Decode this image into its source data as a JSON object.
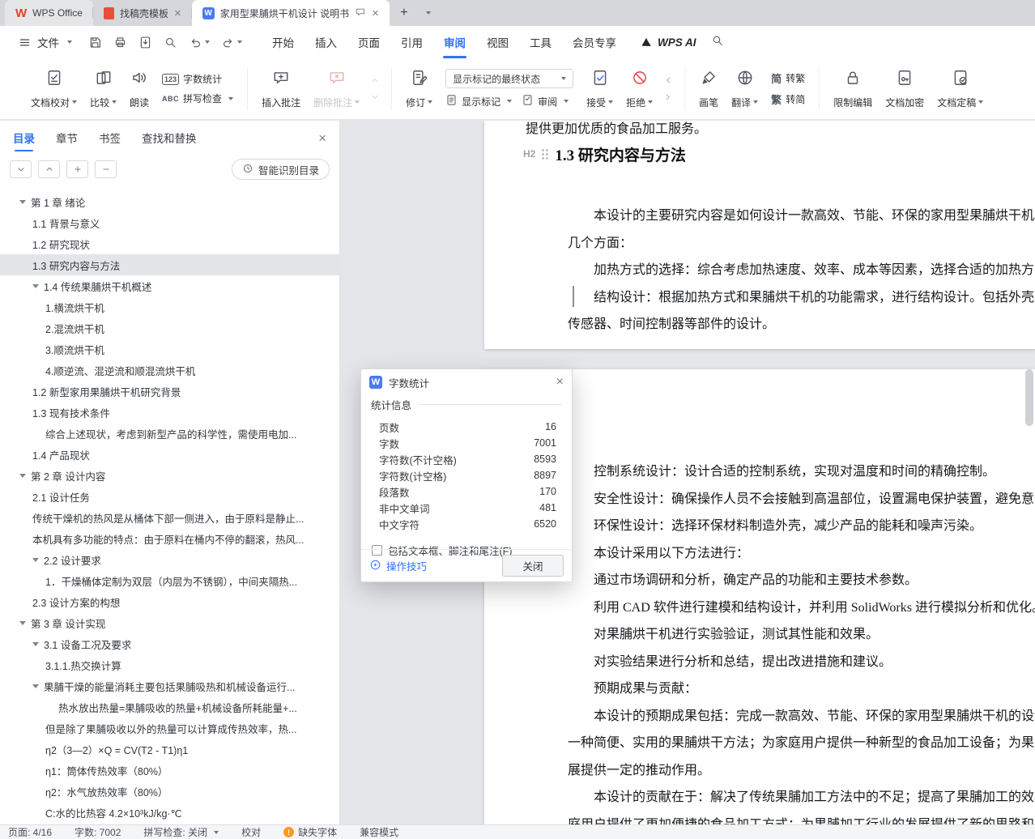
{
  "accent": "#3370ff",
  "tabbar": {
    "tabs": [
      {
        "label": "WPS Office"
      },
      {
        "label": "找稿壳模板"
      },
      {
        "label": "家用型果脯烘干机设计 说明书",
        "active": true
      }
    ]
  },
  "menubar": {
    "file_label": "文件",
    "items": [
      {
        "label": "开始"
      },
      {
        "label": "插入"
      },
      {
        "label": "页面"
      },
      {
        "label": "引用"
      },
      {
        "label": "审阅",
        "active": true
      },
      {
        "label": "视图"
      },
      {
        "label": "工具"
      },
      {
        "label": "会员专享"
      }
    ],
    "wps_ai_label": "WPS AI"
  },
  "ribbon": {
    "doc_proof": "文档校对",
    "compare": "比较",
    "read_aloud": "朗读",
    "word_count": "字数统计",
    "word_count_icon": "123",
    "spell_check": "拼写检查",
    "spell_icon": "ABC",
    "insert_comment": "插入批注",
    "delete_comment": "删除批注",
    "revise": "修订",
    "markup_state": "显示标记的最终状态",
    "show_markup": "显示标记",
    "review": "审阅",
    "accept": "接受",
    "reject": "拒绝",
    "brush": "画笔",
    "translate": "翻译",
    "to_trad_icon": "简",
    "to_trad": "转繁",
    "to_simp_icon": "繁",
    "to_simp": "转简",
    "restrict_edit": "限制编辑",
    "encrypt": "文档加密",
    "finalize": "文档定稿"
  },
  "sidebar": {
    "tabs": [
      {
        "label": "目录",
        "active": true
      },
      {
        "label": "章节"
      },
      {
        "label": "书签"
      },
      {
        "label": "查找和替换"
      }
    ],
    "smart_button": "智能识别目录",
    "outline": [
      {
        "label": "第 1 章  绪论",
        "level": 0,
        "expandable": true
      },
      {
        "label": "1.1 背景与意义",
        "level": 1
      },
      {
        "label": "1.2 研究现状",
        "level": 1
      },
      {
        "label": "1.3 研究内容与方法",
        "level": 1,
        "selected": true
      },
      {
        "label": "1.4 传统果脯烘干机概述",
        "level": 1,
        "expandable": true
      },
      {
        "label": "1.横流烘干机",
        "level": 2
      },
      {
        "label": "2.混流烘干机",
        "level": 2
      },
      {
        "label": "3.顺流烘干机",
        "level": 2
      },
      {
        "label": "4.顺逆流、混逆流和顺混流烘干机",
        "level": 2
      },
      {
        "label": "1.2 新型家用果脯烘干机研究背景",
        "level": 1
      },
      {
        "label": "1.3 现有技术条件",
        "level": 1
      },
      {
        "label": "综合上述现状，考虑到新型产品的科学性，需使用电加...",
        "level": 2
      },
      {
        "label": "1.4 产品现状",
        "level": 1
      },
      {
        "label": "第 2 章  设计内容",
        "level": 0,
        "expandable": true
      },
      {
        "label": "2.1 设计任务",
        "level": 1
      },
      {
        "label": "传统干燥机的热风是从桶体下部一侧进入，由于原料是静止...",
        "level": 1
      },
      {
        "label": "本机具有多功能的特点：由于原料在桶内不停的翻滚，热风...",
        "level": 1
      },
      {
        "label": "2.2  设计要求",
        "level": 1,
        "expandable": true
      },
      {
        "label": "1．干燥桶体定制为双层（内层为不锈钢），中间夹隔热...",
        "level": 2
      },
      {
        "label": "2.3 设计方案的构想",
        "level": 1
      },
      {
        "label": "第 3 章  设计实现",
        "level": 0,
        "expandable": true
      },
      {
        "label": "3.1 设备工况及要求",
        "level": 1,
        "expandable": true
      },
      {
        "label": "3.1.1.热交换计算",
        "level": 2
      },
      {
        "label": "果脯干燥的能量消耗主要包括果脯吸热和机械设备运行...",
        "level": 1,
        "expandable": true
      },
      {
        "label": "热水放出热量=果脯吸收的热量+机械设备所耗能量+...",
        "level": 3
      },
      {
        "label": "但是除了果脯吸收以外的热量可以计算成传热效率，热...",
        "level": 2
      },
      {
        "label": "η2（3—2）×Q = CV(T2 - T1)η1",
        "level": 2
      },
      {
        "label": "η1：筒体传热效率（80%）",
        "level": 2
      },
      {
        "label": "η2：水气放热效率（80%）",
        "level": 2
      },
      {
        "label": "C:水的比热容 4.2×10³kJ/kg·℃",
        "level": 2
      }
    ]
  },
  "document": {
    "page1": {
      "partial_line": "提供更加优质的食品加工服务。",
      "heading_tag": "H2",
      "heading": "1.3 研究内容与方法",
      "lines": [
        {
          "text": "本设计的主要研究内容是如何设计一款高效、节能、环保的家用型果脯烘干机。具体包括",
          "indent": true
        },
        {
          "text": "几个方面："
        },
        {
          "text": "加热方式的选择：综合考虑加热速度、效率、成本等因素，选择合适的加热方式。",
          "indent": true
        },
        {
          "text": "结构设计：根据加热方式和果脯烘干机的功能需求，进行结构设计。包括外壳、加热器、",
          "indent": true
        },
        {
          "text": "传感器、时间控制器等部件的设计。"
        }
      ]
    },
    "page2": {
      "lines": [
        {
          "text": "控制系统设计：设计合适的控制系统，实现对温度和时间的精确控制。",
          "indent": true
        },
        {
          "text": "安全性设计：确保操作人员不会接触到高温部位，设置漏电保护装置，避免意外触电。",
          "indent": true
        },
        {
          "text": "环保性设计：选择环保材料制造外壳，减少产品的能耗和噪声污染。",
          "indent": true
        },
        {
          "text": "本设计采用以下方法进行：",
          "indent": true
        },
        {
          "text": "通过市场调研和分析，确定产品的功能和主要技术参数。",
          "indent": true
        },
        {
          "text": "利用 CAD 软件进行建模和结构设计，并利用 SolidWorks 进行模拟分析和优化。",
          "indent": true
        },
        {
          "text": "对果脯烘干机进行实验验证，测试其性能和效果。",
          "indent": true
        },
        {
          "text": "对实验结果进行分析和总结，提出改进措施和建议。",
          "indent": true
        },
        {
          "text": "预期成果与贡献：",
          "indent": true
        },
        {
          "text": "本设计的预期成果包括：完成一款高效、节能、环保的家用型果脯烘干机的设计和制作；",
          "indent": true
        },
        {
          "text": "一种简便、实用的果脯烘干方法；为家庭用户提供一种新型的食品加工设备；为果脯加工行"
        },
        {
          "text": "展提供一定的推动作用。"
        },
        {
          "text": "本设计的贡献在于：解决了传统果脯加工方法中的不足；提高了果脯加工的效率和品质；",
          "indent": true
        },
        {
          "text": "庭用户提供了更加便捷的食品加工方式；为果脯加工行业的发展提供了新的思路和方法。"
        }
      ]
    }
  },
  "dialog": {
    "title": "字数统计",
    "group": "统计信息",
    "stats": [
      {
        "label": "页数",
        "value": "16"
      },
      {
        "label": "字数",
        "value": "7001"
      },
      {
        "label": "字符数(不计空格)",
        "value": "8593"
      },
      {
        "label": "字符数(计空格)",
        "value": "8897"
      },
      {
        "label": "段落数",
        "value": "170"
      },
      {
        "label": "非中文单词",
        "value": "481"
      },
      {
        "label": "中文字符",
        "value": "6520"
      }
    ],
    "checkbox_label": "包括文本框、脚注和尾注(F)",
    "tips": "操作技巧",
    "close": "关闭"
  },
  "statusbar": {
    "page": "页面: 4/16",
    "words": "字数: 7002",
    "spell": "拼写检查: 关闭",
    "proof": "校对",
    "missing_font": "缺失字体",
    "compat": "兼容模式"
  }
}
